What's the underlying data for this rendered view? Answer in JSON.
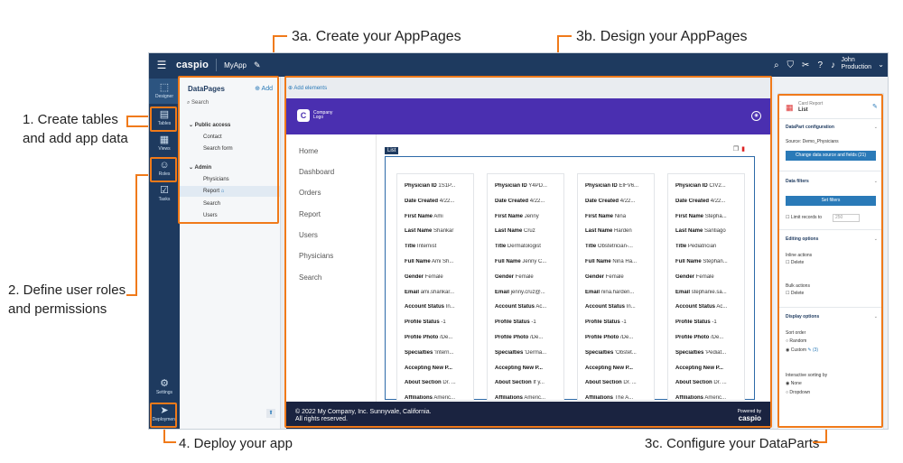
{
  "annotations": {
    "create_tables_1": "1. Create tables",
    "create_tables_2": "and add app data",
    "user_roles_1": "2. Define user roles",
    "user_roles_2": "and permissions",
    "create_apppages": "3a. Create your AppPages",
    "design_apppages": "3b. Design your AppPages",
    "configure_dataparts": "3c. Configure your DataParts",
    "deploy": "4. Deploy your app"
  },
  "topbar": {
    "brand": "caspio",
    "app_name": "MyApp",
    "user_name": "John",
    "user_env": "Production"
  },
  "leftnav": [
    {
      "icon": "designer-icon",
      "glyph": "⬚",
      "label": "Designer"
    },
    {
      "icon": "tables-icon",
      "glyph": "▤",
      "label": "Tables"
    },
    {
      "icon": "views-icon",
      "glyph": "▦",
      "label": "Views"
    },
    {
      "icon": "roles-icon",
      "glyph": "☺",
      "label": "Roles"
    },
    {
      "icon": "tasks-icon",
      "glyph": "☑",
      "label": "Tasks"
    },
    {
      "icon": "settings-icon",
      "glyph": "⚙",
      "label": "Settings"
    },
    {
      "icon": "deployment-icon",
      "glyph": "➤",
      "label": "Deployment"
    }
  ],
  "datapages": {
    "title": "DataPages",
    "add": "Add",
    "search_placeholder": "Search",
    "groups": [
      {
        "name": "Public access",
        "items": [
          "Contact",
          "Search form"
        ]
      },
      {
        "name": "Admin",
        "items": [
          "Physicians",
          "Report",
          "Search",
          "Users"
        ]
      }
    ]
  },
  "canvas": {
    "add_elements": "Add elements",
    "company_name": "Company",
    "company_sub": "Logo",
    "nav": [
      "Home",
      "Dashboard",
      "Orders",
      "Report",
      "Users",
      "Physicians",
      "Search"
    ],
    "list_tag": "List",
    "footer_line1": "© 2022 My Company, Inc. Sunnyvale, California.",
    "footer_line2": "All rights reserved.",
    "powered_by": "Powered by",
    "powered_brand": "caspio"
  },
  "list": {
    "field_labels": [
      "Physician ID",
      "Date Created",
      "First Name",
      "Last Name",
      "Title",
      "Full Name",
      "Gender",
      "Email",
      "Account Status",
      "Profile Status",
      "Profile Photo",
      "Specialties",
      "Accepting New P...",
      "About Section",
      "Affiliations"
    ],
    "cards": [
      {
        "values": [
          "1S1P...",
          "4/22...",
          "Ami",
          "Shankar",
          "Internist",
          "Ami Sh...",
          "Female",
          "ami.shankar...",
          "In...",
          "-1",
          "/De...",
          "'Intern...",
          "",
          "Dr. ...",
          "Americ..."
        ]
      },
      {
        "values": [
          "Y4PD...",
          "4/22...",
          "Jenny",
          "Cruz",
          "Dermatologist",
          "Jenny C...",
          "Female",
          "jenny.cruz@...",
          "Ac...",
          "-1",
          "/De...",
          "'Derma...",
          "",
          "If y...",
          "Americ..."
        ]
      },
      {
        "values": [
          "EIFV6...",
          "4/22...",
          "Nina",
          "Harden",
          "Obstetrician-...",
          "Nina Ha...",
          "Female",
          "nina.harden...",
          "In...",
          "-1",
          "/De...",
          "'Obstet...",
          "",
          "Dr. ...",
          "The A..."
        ]
      },
      {
        "values": [
          "CIV2...",
          "4/22...",
          "Stepha...",
          "Santiago",
          "Pediatrician",
          "Stephan...",
          "Female",
          "stephanie.sa...",
          "Ac...",
          "-1",
          "/De...",
          "'Pediat...",
          "",
          "Dr. ...",
          "Americ..."
        ]
      }
    ]
  },
  "props": {
    "header_small": "Card Report",
    "header_main": "List",
    "dp_config": "DataPart configuration",
    "source": "Source: Demo_Physicians",
    "change_btn": "Change data source and fields (21)",
    "data_filters": "Data filters",
    "set_filters": "Set filters",
    "limit_records": "Limit records to",
    "limit_value": "250",
    "editing": "Editing options",
    "inline": "Inline actions",
    "delete1": "Delete",
    "bulk": "Bulk actions",
    "delete2": "Delete",
    "display": "Display options",
    "sort_order": "Sort order",
    "random": "Random",
    "custom": "Custom",
    "custom_count": "(3)",
    "interactive": "Interactive sorting by",
    "none": "None",
    "dropdown": "Dropdown"
  }
}
